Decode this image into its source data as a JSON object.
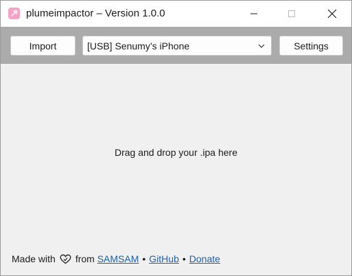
{
  "window": {
    "title": "plumeimpactor – Version 1.0.0",
    "icon": "app-icon",
    "controls": [
      "minimize-icon",
      "maximize-icon",
      "close-icon"
    ]
  },
  "toolbar": {
    "import_label": "Import",
    "device_select": {
      "selected": "[USB] Senumy’s iPhone"
    },
    "settings_label": "Settings"
  },
  "main": {
    "drop_hint": "Drag and drop your .ipa here"
  },
  "footer": {
    "made_with": "Made with",
    "from": "from",
    "links": [
      "SAMSAM",
      "GitHub",
      "Donate"
    ],
    "separator": "•",
    "heart_icon": "heart-icon"
  },
  "colors": {
    "toolbar_bg": "#ababab",
    "window_bg": "#f0f0f0",
    "link": "#1a5fb4",
    "icon_bg": "#f4a3c6"
  }
}
